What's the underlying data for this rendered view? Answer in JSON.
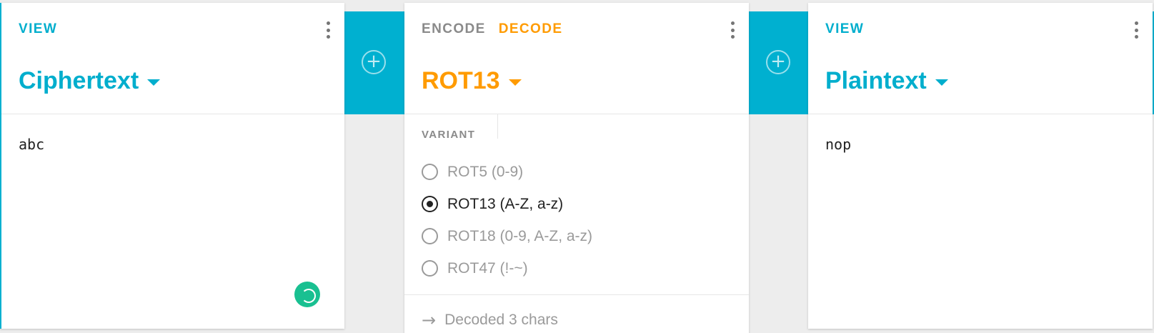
{
  "colors": {
    "accent": "#00aecd",
    "operation": "#ff9b00",
    "success": "#19c091"
  },
  "left_card": {
    "label": "VIEW",
    "format": "Ciphertext",
    "text": "abc"
  },
  "middle_card": {
    "tabs": [
      "ENCODE",
      "DECODE"
    ],
    "active_tab": "DECODE",
    "title": "ROT13",
    "variant_label": "VARIANT",
    "options": [
      {
        "label": "ROT5 (0-9)",
        "selected": false
      },
      {
        "label": "ROT13 (A-Z, a-z)",
        "selected": true
      },
      {
        "label": "ROT18 (0-9, A-Z, a-z)",
        "selected": false
      },
      {
        "label": "ROT47 (!-~)",
        "selected": false
      }
    ],
    "status": "Decoded 3 chars"
  },
  "right_card": {
    "label": "VIEW",
    "format": "Plaintext",
    "text": "nop"
  },
  "icons": {
    "add_1": "plus-circle-icon",
    "add_2": "plus-circle-icon",
    "menu": "kebab-menu-icon",
    "status_arrow": "arrow-right-icon",
    "loading": "spinner-icon"
  }
}
